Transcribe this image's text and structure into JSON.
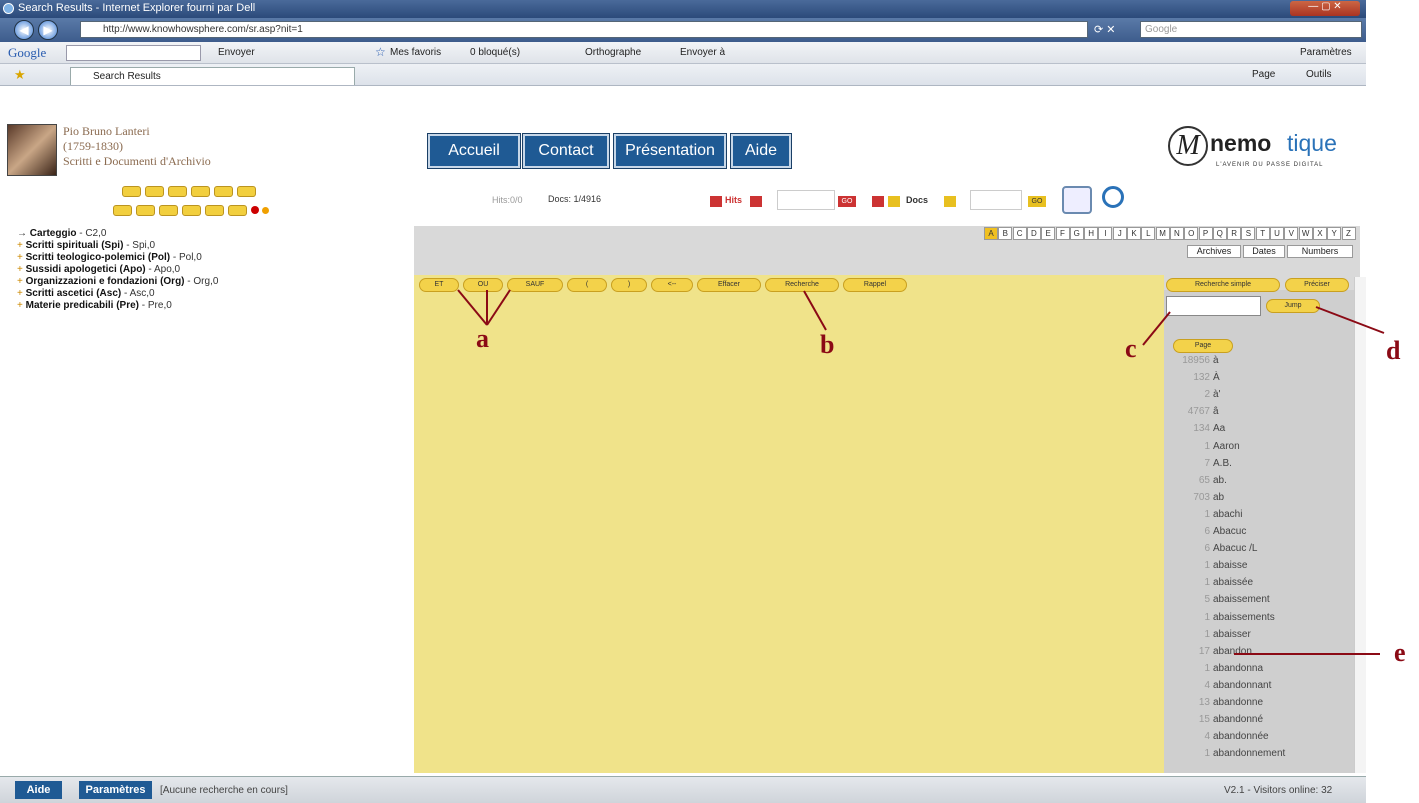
{
  "window": {
    "title": "Search Results - Internet Explorer fourni par Dell"
  },
  "address": {
    "url": "http://www.knowhowsphere.com/sr.asp?nit=1",
    "search_placeholder": "Google"
  },
  "google_bar": {
    "logo": "Google",
    "envoyer": "Envoyer",
    "favoris": "Mes favoris",
    "bloques": "0 bloqué(s)",
    "orthographe": "Orthographe",
    "envoyer_a": "Envoyer à",
    "parametres": "Paramètres"
  },
  "fav_bar": {
    "tab": "Search Results",
    "page": "Page",
    "outils": "Outils"
  },
  "header": {
    "name": "Pio Bruno Lanteri",
    "dates": "(1759-1830)",
    "subtitle": "Scritti e Documenti d'Archivio"
  },
  "nav": {
    "accueil": "Accueil",
    "contact": "Contact",
    "presentation": "Présentation",
    "aide": "Aide"
  },
  "logo": {
    "brand_a": "nemo",
    "brand_b": "tique",
    "tagline": "L'AVENIR DU PASSE DIGITAL"
  },
  "stats": {
    "hits": "Hits:0/0",
    "docs": "Docs: 1/4916",
    "hits_label": "Hits",
    "docs_label": "Docs",
    "go": "GO"
  },
  "tree": [
    {
      "name": "Carteggio",
      "code": " - C2,0"
    },
    {
      "name": "Scritti spirituali (Spi)",
      "code": " - Spi,0"
    },
    {
      "name": "Scritti teologico-polemici (Pol)",
      "code": " - Pol,0"
    },
    {
      "name": "Sussidi apologetici (Apo)",
      "code": " - Apo,0"
    },
    {
      "name": "Organizzazioni e fondazioni (Org)",
      "code": " - Org,0"
    },
    {
      "name": "Scritti ascetici (Asc)",
      "code": " - Asc,0"
    },
    {
      "name": "Materie predicabili (Pre)",
      "code": " - Pre,0"
    }
  ],
  "alphabet": [
    "A",
    "B",
    "C",
    "D",
    "E",
    "F",
    "G",
    "H",
    "I",
    "J",
    "K",
    "L",
    "M",
    "N",
    "O",
    "P",
    "Q",
    "R",
    "S",
    "T",
    "U",
    "V",
    "W",
    "X",
    "Y",
    "Z"
  ],
  "index_tabs": {
    "archives": "Archives",
    "dates": "Dates",
    "numbers": "Numbers"
  },
  "operators": {
    "et": "ET",
    "ou": "OU",
    "sauf": "SAUF",
    "p1": "(",
    "p2": ")",
    "arrow": "<--",
    "effacer": "Effacer",
    "recherche": "Recherche",
    "rappel": "Rappel"
  },
  "right_panel": {
    "simple": "Recherche simple",
    "preciser": "Préciser",
    "jump": "Jump",
    "page": "Page"
  },
  "words": [
    {
      "n": "18956",
      "w": "à"
    },
    {
      "n": "132",
      "w": "À"
    },
    {
      "n": "2",
      "w": "à'"
    },
    {
      "n": "4767",
      "w": "â"
    },
    {
      "n": "134",
      "w": "Aa"
    },
    {
      "n": "1",
      "w": "Aaron"
    },
    {
      "n": "7",
      "w": "A.B."
    },
    {
      "n": "65",
      "w": "ab."
    },
    {
      "n": "703",
      "w": "ab"
    },
    {
      "n": "1",
      "w": "abachi"
    },
    {
      "n": "6",
      "w": "Abacuc"
    },
    {
      "n": "6",
      "w": "Abacuc /L"
    },
    {
      "n": "1",
      "w": "abaisse"
    },
    {
      "n": "1",
      "w": "abaissée"
    },
    {
      "n": "5",
      "w": "abaissement"
    },
    {
      "n": "1",
      "w": "abaissements"
    },
    {
      "n": "1",
      "w": "abaisser"
    },
    {
      "n": "17",
      "w": "abandon"
    },
    {
      "n": "1",
      "w": "abandonna"
    },
    {
      "n": "4",
      "w": "abandonnant"
    },
    {
      "n": "13",
      "w": "abandonne"
    },
    {
      "n": "15",
      "w": "abandonné"
    },
    {
      "n": "4",
      "w": "abandonnée"
    },
    {
      "n": "1",
      "w": "abandonnement"
    }
  ],
  "annotations": {
    "a": "a",
    "b": "b",
    "c": "c",
    "d": "d",
    "e": "e"
  },
  "status": {
    "aide": "Aide",
    "parametres": "Paramètres",
    "message": "[Aucune recherche en cours]",
    "version": "V2.1 - Visitors online: 32"
  }
}
